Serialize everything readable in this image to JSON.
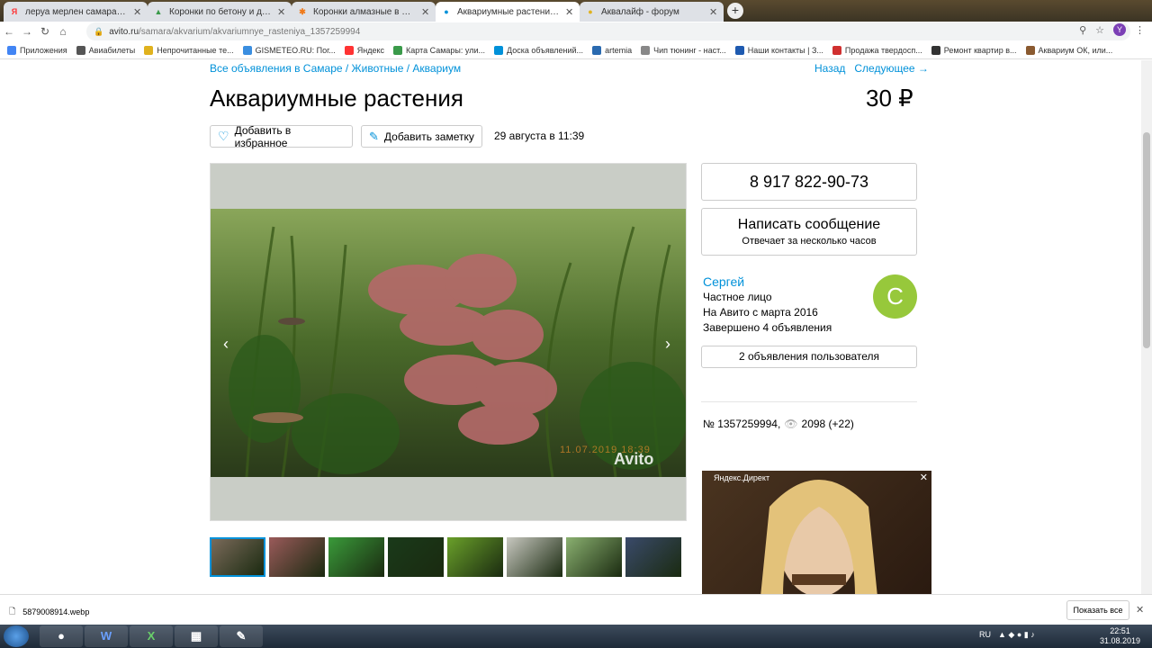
{
  "tabs": [
    {
      "title": "леруа мерлен самара — Яндекс",
      "icon": "yandex-icon",
      "color": "#f33"
    },
    {
      "title": "Коронки по бетону и другим ма",
      "icon": "triangle-icon",
      "color": "#3a9a4a"
    },
    {
      "title": "Коронки алмазные в Самаре —",
      "icon": "asterisk-icon",
      "color": "#f07a1a"
    },
    {
      "title": "Аквариумные растения - купит",
      "icon": "avito-icon",
      "color": "#0091d9"
    },
    {
      "title": "Аквалайф - форум",
      "icon": "forum-icon",
      "color": "#e0b21e"
    }
  ],
  "address": {
    "domain": "avito.ru",
    "path": "/samara/akvarium/akvariumnye_rasteniya_1357259994"
  },
  "bookmarks": [
    {
      "label": "Приложения",
      "icon": "apps-icon",
      "color": "#4285f4"
    },
    {
      "label": "Авиабилеты",
      "icon": "plane-icon",
      "color": "#555"
    },
    {
      "label": "Непрочитанные те...",
      "icon": "bookmark-icon",
      "color": "#e0b21e"
    },
    {
      "label": "GISMETEO.RU: Пог...",
      "icon": "drop-icon",
      "color": "#3a8ee0"
    },
    {
      "label": "Яндекс",
      "icon": "yandex-icon",
      "color": "#f33"
    },
    {
      "label": "Карта Самары: ули...",
      "icon": "map-icon",
      "color": "#3a9a4a"
    },
    {
      "label": "Доска объявлений...",
      "icon": "avito-icon",
      "color": "#0091d9"
    },
    {
      "label": "artemia",
      "icon": "x-icon",
      "color": "#2a6ab0"
    },
    {
      "label": "Чип тюнинг - наст...",
      "icon": "page-icon",
      "color": "#888"
    },
    {
      "label": "Наши контакты | З...",
      "icon": "globe-icon",
      "color": "#1e5ab0"
    },
    {
      "label": "Продажа твердосп...",
      "icon": "arrow-icon",
      "color": "#d03030"
    },
    {
      "label": "Ремонт квартир в...",
      "icon": "tool-icon",
      "color": "#333"
    },
    {
      "label": "Аквариум ОК, или...",
      "icon": "image-icon",
      "color": "#8a5a30"
    }
  ],
  "breadcrumb": "Все объявления в Самаре / Животные / Аквариум",
  "nav": {
    "back": "Назад",
    "next": "Следующее →"
  },
  "title": "Аквариумные растения",
  "price": "30 ₽",
  "actions": {
    "favorite": "Добавить в избранное",
    "note": "Добавить заметку"
  },
  "date": "29 августа в 11:39",
  "photo_watermark": {
    "date": "11.07.2019 18:39",
    "logo": "Avito"
  },
  "thumbs": [
    {
      "color": "#7a6a5a"
    },
    {
      "color": "#9a5a5a"
    },
    {
      "color": "#3a9a3a"
    },
    {
      "color": "#1a3a1a"
    },
    {
      "color": "#6aa02a"
    },
    {
      "color": "#c8c8c0"
    },
    {
      "color": "#8ab070"
    },
    {
      "color": "#3a4a6a"
    }
  ],
  "contact": {
    "phone": "8 917 822-90-73",
    "message": "Написать сообщение",
    "message_sub": "Отвечает за несколько часов"
  },
  "seller": {
    "name": "Сергей",
    "type": "Частное лицо",
    "since": "На Авито с марта 2016",
    "completed": "Завершено 4 объявления",
    "avatar_letter": "С",
    "ads_button": "2 объявления пользователя"
  },
  "stats": {
    "id": "№ 1357259994,",
    "views": "2098 (+22)"
  },
  "ad": {
    "label": "Яндекс.Директ",
    "close": "✕"
  },
  "download": {
    "filename": "5879008914.webp",
    "show_all": "Показать все"
  },
  "taskbar": {
    "lang": "RU",
    "time": "22:51",
    "date": "31.08.2019"
  }
}
